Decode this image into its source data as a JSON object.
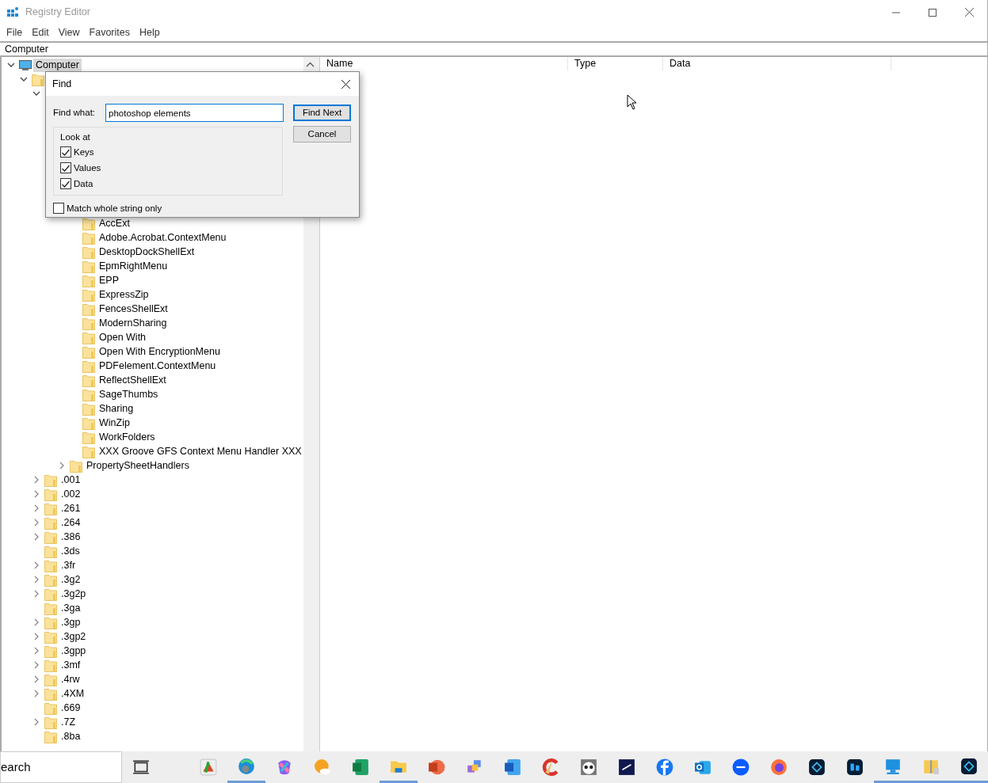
{
  "window": {
    "title": "Registry Editor",
    "active": false
  },
  "menu": [
    "File",
    "Edit",
    "View",
    "Favorites",
    "Help"
  ],
  "address": "Computer",
  "tree": [
    {
      "label": "Computer",
      "kind": "computer",
      "expandable": true,
      "expanded": true,
      "selected": true,
      "children": [
        {
          "kind": "folder",
          "expandable": true,
          "expanded": true,
          "children": [
            {
              "expandable": true,
              "expanded": true,
              "children": [
                {
                  "children": [
                    {
                      "children": [
                        {
                          "label": "AccExt",
                          "kind": "folder",
                          "expandable": false,
                          "selected": false
                        },
                        {
                          "label": "Adobe.Acrobat.ContextMenu",
                          "kind": "folder",
                          "expandable": false,
                          "selected": false
                        },
                        {
                          "label": "DesktopDockShellExt",
                          "kind": "folder",
                          "expandable": false,
                          "selected": false
                        },
                        {
                          "label": "EpmRightMenu",
                          "kind": "folder",
                          "expandable": false,
                          "selected": false
                        },
                        {
                          "label": "EPP",
                          "kind": "folder",
                          "expandable": false,
                          "selected": false
                        },
                        {
                          "label": "ExpressZip",
                          "kind": "folder",
                          "expandable": false,
                          "selected": false
                        },
                        {
                          "label": "FencesShellExt",
                          "kind": "folder",
                          "expandable": false,
                          "selected": false
                        },
                        {
                          "label": "ModernSharing",
                          "kind": "folder",
                          "expandable": false,
                          "selected": false
                        },
                        {
                          "label": "Open With",
                          "kind": "folder",
                          "expandable": false,
                          "selected": false
                        },
                        {
                          "label": "Open With EncryptionMenu",
                          "kind": "folder",
                          "expandable": false,
                          "selected": false
                        },
                        {
                          "label": "PDFelement.ContextMenu",
                          "kind": "folder",
                          "expandable": false,
                          "selected": false
                        },
                        {
                          "label": "ReflectShellExt",
                          "kind": "folder",
                          "expandable": false,
                          "selected": false
                        },
                        {
                          "label": "SageThumbs",
                          "kind": "folder",
                          "expandable": false,
                          "selected": false
                        },
                        {
                          "label": "Sharing",
                          "kind": "folder",
                          "expandable": false,
                          "selected": false
                        },
                        {
                          "label": "WinZip",
                          "kind": "folder",
                          "expandable": false,
                          "selected": false
                        },
                        {
                          "label": "WorkFolders",
                          "kind": "folder",
                          "expandable": false,
                          "selected": false
                        },
                        {
                          "label": "XXX Groove GFS Context Menu Handler XXX",
                          "kind": "folder",
                          "expandable": false,
                          "selected": false
                        }
                      ]
                    },
                    {
                      "label": "PropertySheetHandlers",
                      "kind": "folder",
                      "expandable": true,
                      "expanded": false,
                      "selected": false
                    }
                  ]
                }
              ]
            },
            {
              "label": ".001",
              "kind": "folder",
              "expandable": true,
              "expanded": false,
              "selected": false
            },
            {
              "label": ".002",
              "kind": "folder",
              "expandable": true,
              "expanded": false,
              "selected": false
            },
            {
              "label": ".261",
              "kind": "folder",
              "expandable": true,
              "expanded": false,
              "selected": false
            },
            {
              "label": ".264",
              "kind": "folder",
              "expandable": true,
              "expanded": false,
              "selected": false
            },
            {
              "label": ".386",
              "kind": "folder",
              "expandable": true,
              "expanded": false,
              "selected": false
            },
            {
              "label": ".3ds",
              "kind": "folder",
              "expandable": false,
              "selected": false
            },
            {
              "label": ".3fr",
              "kind": "folder",
              "expandable": true,
              "expanded": false,
              "selected": false
            },
            {
              "label": ".3g2",
              "kind": "folder",
              "expandable": true,
              "expanded": false,
              "selected": false
            },
            {
              "label": ".3g2p",
              "kind": "folder",
              "expandable": true,
              "expanded": false,
              "selected": false
            },
            {
              "label": ".3ga",
              "kind": "folder",
              "expandable": false,
              "selected": false
            },
            {
              "label": ".3gp",
              "kind": "folder",
              "expandable": true,
              "expanded": false,
              "selected": false
            },
            {
              "label": ".3gp2",
              "kind": "folder",
              "expandable": true,
              "expanded": false,
              "selected": false
            },
            {
              "label": ".3gpp",
              "kind": "folder",
              "expandable": true,
              "expanded": false,
              "selected": false
            },
            {
              "label": ".3mf",
              "kind": "folder",
              "expandable": true,
              "expanded": false,
              "selected": false
            },
            {
              "label": ".4rw",
              "kind": "folder",
              "expandable": true,
              "expanded": false,
              "selected": false
            },
            {
              "label": ".4XM",
              "kind": "folder",
              "expandable": true,
              "expanded": false,
              "selected": false
            },
            {
              "label": ".669",
              "kind": "folder",
              "expandable": false,
              "selected": false
            },
            {
              "label": ".7Z",
              "kind": "folder",
              "expandable": true,
              "expanded": false,
              "selected": false
            },
            {
              "label": ".8ba",
              "kind": "folder",
              "expandable": false,
              "selected": false
            }
          ]
        }
      ]
    }
  ],
  "columns": [
    "Name",
    "Type",
    "Data"
  ],
  "find_dialog": {
    "title": "Find",
    "find_what_label": "Find what:",
    "value": "photoshop elements",
    "find_next": "Find Next",
    "cancel": "Cancel",
    "look_at": "Look at",
    "options": [
      {
        "label": "Keys",
        "checked": true
      },
      {
        "label": "Values",
        "checked": true
      },
      {
        "label": "Data",
        "checked": true
      }
    ],
    "match_whole": {
      "label": "Match whole string only",
      "checked": false
    }
  },
  "taskbar": {
    "search": "earch",
    "apps": [
      {
        "kind": "taskview",
        "running": false
      },
      {
        "kind": "snip",
        "running": false
      },
      {
        "kind": "edge",
        "running": true
      },
      {
        "kind": "copilot",
        "running": false
      },
      {
        "kind": "weather",
        "running": false
      },
      {
        "kind": "excel",
        "running": false
      },
      {
        "kind": "explorer",
        "running": true
      },
      {
        "kind": "powerpoint",
        "running": false
      },
      {
        "kind": "puzzle",
        "running": false
      },
      {
        "kind": "word",
        "running": false
      },
      {
        "kind": "cleaner",
        "running": false
      },
      {
        "kind": "panda",
        "running": false
      },
      {
        "kind": "darkapp",
        "running": false
      },
      {
        "kind": "facebook",
        "running": false
      },
      {
        "kind": "outlook",
        "running": false
      },
      {
        "kind": "zoom",
        "running": false
      },
      {
        "kind": "firefox",
        "running": false
      },
      {
        "kind": "elements",
        "running": false
      },
      {
        "kind": "photoshop",
        "running": false
      },
      {
        "kind": "monitor",
        "running": true
      },
      {
        "kind": "zip",
        "running": true
      },
      {
        "kind": "elements",
        "running": true
      }
    ]
  }
}
